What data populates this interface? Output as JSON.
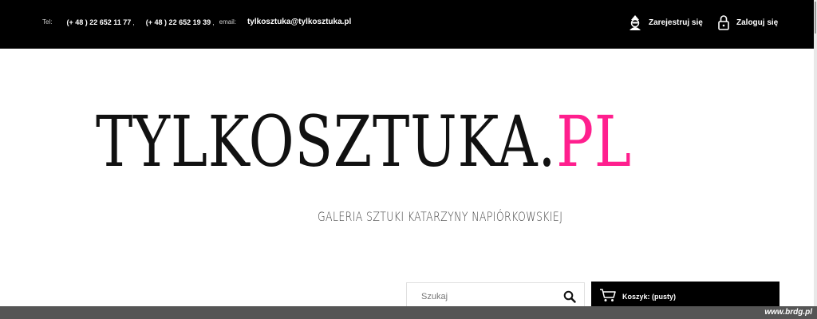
{
  "topbar": {
    "tel_label": "Tel:",
    "phone1": "(+ 48 ) 22 652 11 77",
    "sep1": ",",
    "phone2": "(+ 48 ) 22 652 19 39",
    "sep2": ",",
    "email_label": "email:",
    "email": "tylkosztuka@tylkosztuka.pl",
    "register_label": "Zarejestruj się",
    "login_label": "Zaloguj się"
  },
  "logo": {
    "main": "TYLKOSZTUKA",
    "dot": ".",
    "ext": "PL",
    "accent_color": "#ff1f8e"
  },
  "tagline": "GALERIA SZTUKI KATARZYNY NAPIÓRKOWSKIEJ",
  "search": {
    "placeholder": "Szukaj",
    "icon": "search-icon"
  },
  "cart": {
    "label": "Koszyk: (pusty)",
    "icon": "cart-icon"
  },
  "watermark": "www.brdg.pl"
}
